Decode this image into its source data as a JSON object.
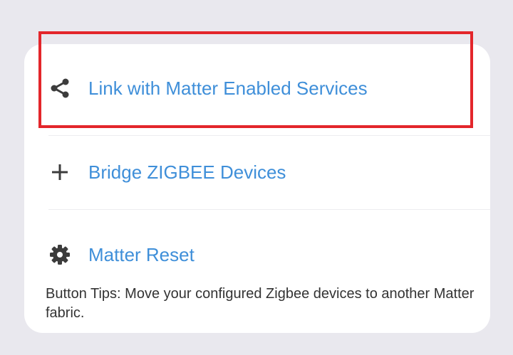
{
  "menu": {
    "items": [
      {
        "label": "Link with Matter Enabled Services",
        "icon": "share-icon"
      },
      {
        "label": "Bridge ZIGBEE Devices",
        "icon": "plus-icon"
      },
      {
        "label": "Matter Reset",
        "icon": "gear-icon"
      }
    ],
    "tips": "Button Tips: Move your configured Zigbee devices to another Matter fabric."
  },
  "colors": {
    "background": "#e9e8ee",
    "card": "#ffffff",
    "link_text": "#3f8fd9",
    "icon": "#3c3c3c",
    "tips_text": "#333333",
    "highlight": "#e3262b"
  }
}
